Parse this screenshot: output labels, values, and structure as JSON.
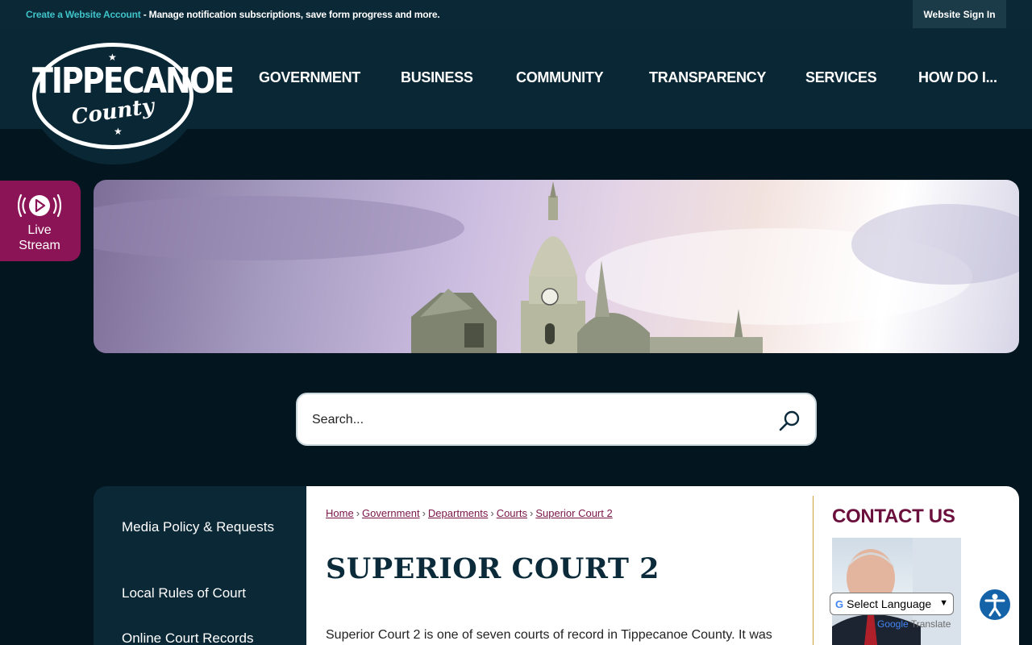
{
  "topbar": {
    "create_link": "Create a Website Account",
    "create_desc": " - Manage notification subscriptions, save form progress and more.",
    "sign_in": "Website Sign In"
  },
  "logo": {
    "main": "TIPPECANOE",
    "sub": "County"
  },
  "nav": [
    "GOVERNMENT",
    "BUSINESS",
    "COMMUNITY",
    "TRANSPARENCY",
    "SERVICES",
    "HOW DO I..."
  ],
  "live_stream": {
    "line1": "Live",
    "line2": "Stream"
  },
  "search": {
    "placeholder": "Search..."
  },
  "sidebar": {
    "items": [
      {
        "label": "Media Policy & Requests"
      },
      {
        "label": "Local Rules of Court"
      },
      {
        "label": "Online Court Records"
      }
    ]
  },
  "breadcrumb": [
    "Home",
    "Government",
    "Departments",
    "Courts",
    "Superior Court 2"
  ],
  "page": {
    "title": "SUPERIOR COURT 2",
    "intro": "Superior Court 2 is one of seven courts of record in Tippecanoe County.  It was"
  },
  "contact": {
    "title": "CONTACT US"
  },
  "translate": {
    "label": "Select Language",
    "powered_by": "Google",
    "translate_word": "Translate"
  },
  "colors": {
    "accent_teal": "#3fc3c9",
    "maroon": "#8b1456",
    "navy": "#0a2735"
  }
}
